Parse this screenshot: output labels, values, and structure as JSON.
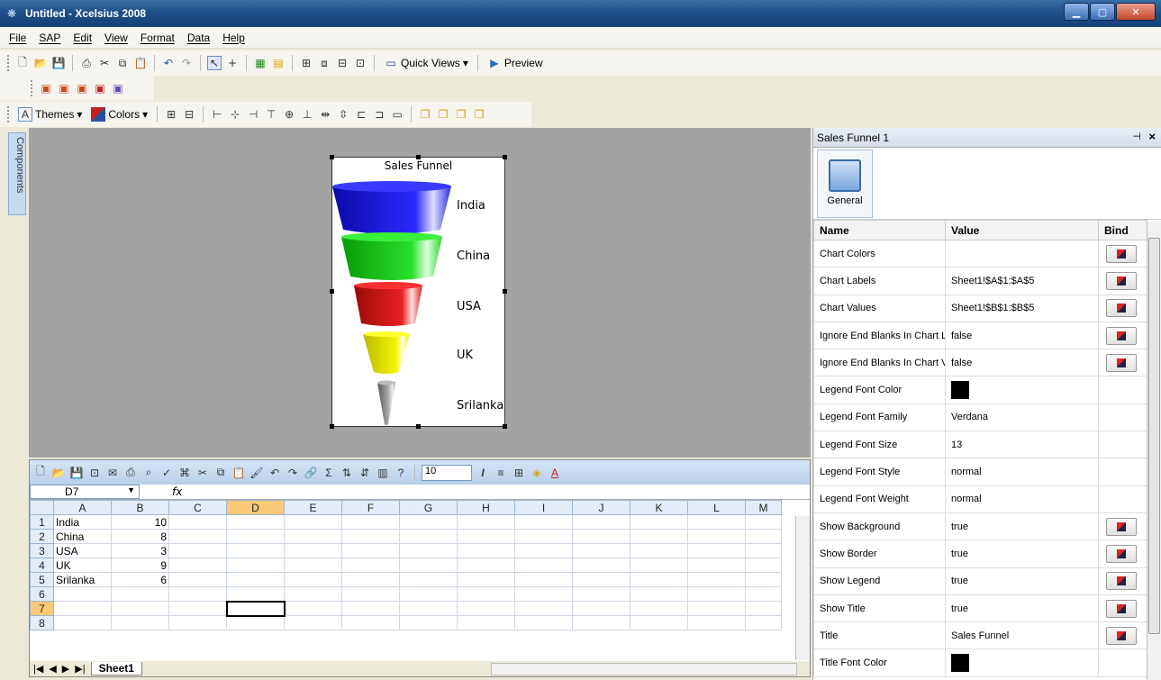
{
  "window": {
    "title": "Untitled - Xcelsius 2008"
  },
  "menu": [
    "File",
    "SAP",
    "Edit",
    "View",
    "Format",
    "Data",
    "Help"
  ],
  "toolbar": {
    "quick_views": "Quick Views",
    "preview": "Preview",
    "themes": "Themes",
    "colors": "Colors"
  },
  "left_tab": {
    "label": "Components"
  },
  "chart": {
    "title": "Sales Funnel",
    "labels": [
      "India",
      "China",
      "USA",
      "UK",
      "Srilanka"
    ],
    "colors": [
      "#1a1ae6",
      "#1fd61f",
      "#e01010",
      "#f0f000",
      "#9a9a9a"
    ]
  },
  "sheet": {
    "namebox": "D7",
    "fx": "fx",
    "columns": [
      "A",
      "B",
      "C",
      "D",
      "E",
      "F",
      "G",
      "H",
      "I",
      "J",
      "K",
      "L",
      "M"
    ],
    "rows": [
      {
        "n": "1",
        "a": "India",
        "b": "10"
      },
      {
        "n": "2",
        "a": "China",
        "b": "8"
      },
      {
        "n": "3",
        "a": "USA",
        "b": "3"
      },
      {
        "n": "4",
        "a": "UK",
        "b": "9"
      },
      {
        "n": "5",
        "a": "Srilanka",
        "b": "6"
      },
      {
        "n": "6",
        "a": "",
        "b": ""
      },
      {
        "n": "7",
        "a": "",
        "b": ""
      },
      {
        "n": "8",
        "a": "",
        "b": ""
      }
    ],
    "tab": "Sheet1",
    "font_size": "10"
  },
  "props": {
    "panel_title": "Sales Funnel 1",
    "general_tab": "General",
    "headers": {
      "name": "Name",
      "value": "Value",
      "bind": "Bind"
    },
    "rows": [
      {
        "name": "Chart Colors",
        "value": "",
        "bind": true
      },
      {
        "name": "Chart Labels",
        "value": "Sheet1!$A$1:$A$5",
        "bind": true
      },
      {
        "name": "Chart Values",
        "value": "Sheet1!$B$1:$B$5",
        "bind": true
      },
      {
        "name": "Ignore End Blanks In Chart L",
        "value": "false",
        "bind": true
      },
      {
        "name": "Ignore End Blanks In Chart V",
        "value": "false",
        "bind": true
      },
      {
        "name": "Legend Font Color",
        "value": "",
        "swatch": true,
        "bind": false
      },
      {
        "name": "Legend Font Family",
        "value": "Verdana",
        "bind": false
      },
      {
        "name": "Legend Font Size",
        "value": "13",
        "bind": false
      },
      {
        "name": "Legend Font Style",
        "value": "normal",
        "bind": false
      },
      {
        "name": "Legend Font Weight",
        "value": "normal",
        "bind": false
      },
      {
        "name": "Show Background",
        "value": "true",
        "bind": true
      },
      {
        "name": "Show Border",
        "value": "true",
        "bind": true
      },
      {
        "name": "Show Legend",
        "value": "true",
        "bind": true
      },
      {
        "name": "Show Title",
        "value": "true",
        "bind": true
      },
      {
        "name": "Title",
        "value": "Sales Funnel",
        "bind": true
      },
      {
        "name": "Title Font Color",
        "value": "",
        "swatch": true,
        "bind": false
      }
    ]
  }
}
